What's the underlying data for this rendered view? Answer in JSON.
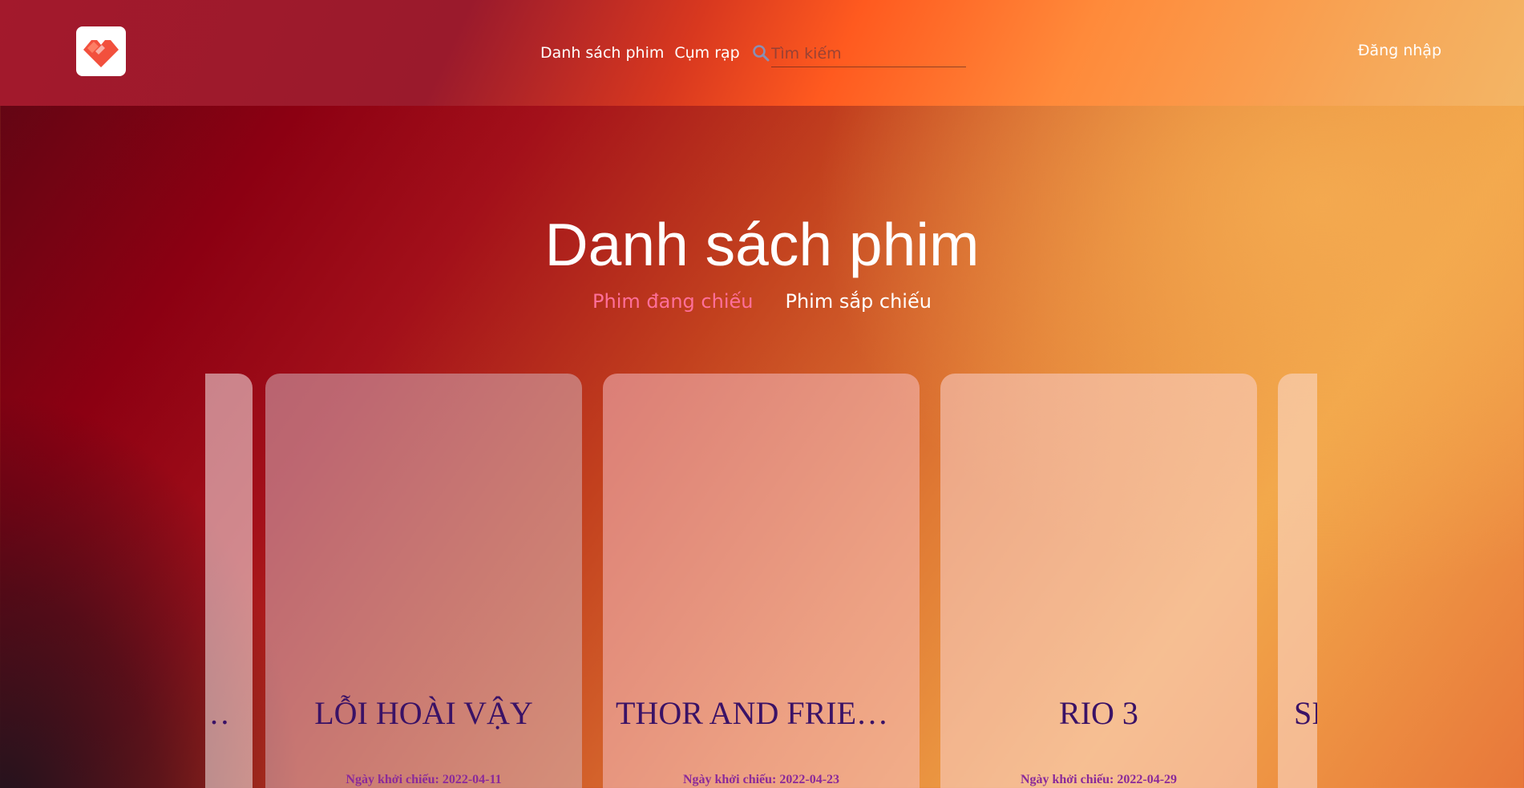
{
  "header": {
    "nav": {
      "movies": "Danh sách phim",
      "cinemas": "Cụm rạp"
    },
    "search": {
      "placeholder": "Tìm kiếm"
    },
    "login": "Đăng nhập",
    "colors": {
      "accent": "#ff5a1f",
      "logo_red": "#f2503d"
    }
  },
  "main": {
    "title": "Danh sách phim",
    "tabs": [
      {
        "label": "Phim đang chiếu",
        "active": true
      },
      {
        "label": "Phim sắp chiếu",
        "active": false
      }
    ]
  },
  "movies": {
    "date_label": "Ngày khởi chiếu:",
    "items": [
      {
        "title": "…",
        "date": ""
      },
      {
        "title": "LỖI HOÀI VẬY",
        "date": "2022-04-11"
      },
      {
        "title": "THOR AND FRIENDS",
        "date": "2022-04-23"
      },
      {
        "title": "RIO 3",
        "date": "2022-04-29"
      },
      {
        "title": "SI",
        "date": ""
      }
    ]
  }
}
